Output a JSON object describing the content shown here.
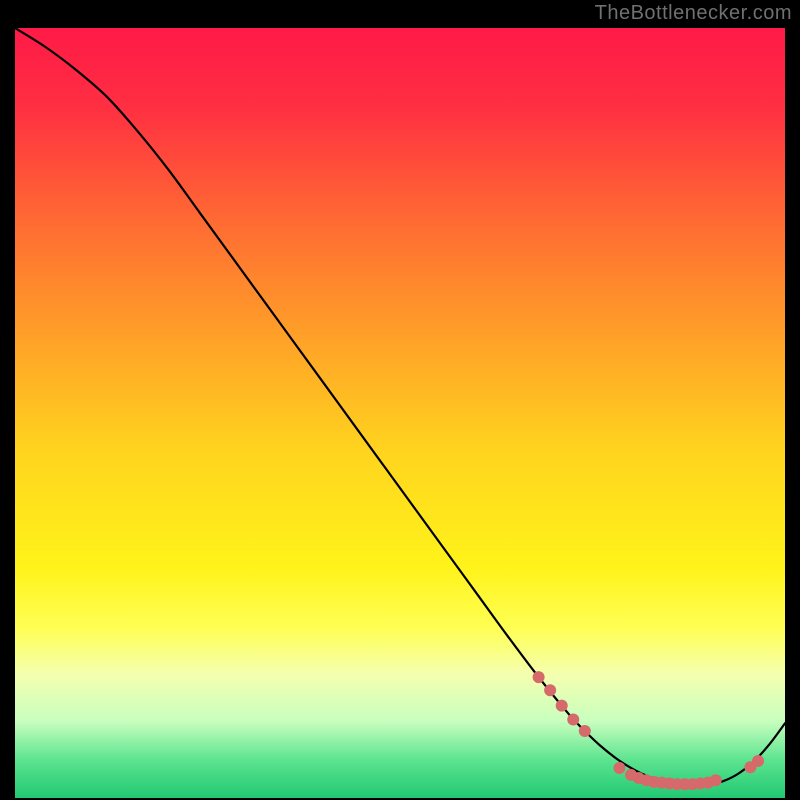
{
  "watermark": "TheBottlenecker.com",
  "chart_data": {
    "type": "line",
    "title": "",
    "xlabel": "",
    "ylabel": "",
    "xlim": [
      0,
      100
    ],
    "ylim": [
      0,
      100
    ],
    "gradient_stops": [
      {
        "offset": 0.0,
        "color": "#ff1a47"
      },
      {
        "offset": 0.1,
        "color": "#ff2e42"
      },
      {
        "offset": 0.25,
        "color": "#ff6a33"
      },
      {
        "offset": 0.4,
        "color": "#ffa028"
      },
      {
        "offset": 0.55,
        "color": "#ffd41e"
      },
      {
        "offset": 0.7,
        "color": "#fff31a"
      },
      {
        "offset": 0.78,
        "color": "#ffff55"
      },
      {
        "offset": 0.84,
        "color": "#f4ffb0"
      },
      {
        "offset": 0.9,
        "color": "#c8ffbe"
      },
      {
        "offset": 0.95,
        "color": "#5de490"
      },
      {
        "offset": 1.0,
        "color": "#22c873"
      }
    ],
    "series": [
      {
        "name": "bottleneck-curve",
        "x": [
          0,
          4,
          8,
          12,
          16,
          20,
          24,
          28,
          32,
          36,
          40,
          44,
          48,
          52,
          56,
          60,
          64,
          68,
          72,
          74,
          76,
          78,
          80,
          82,
          84,
          86,
          88,
          90,
          92,
          94,
          96,
          98,
          100
        ],
        "y": [
          100,
          97.5,
          94.5,
          91,
          86.5,
          81.5,
          76,
          70.5,
          65,
          59.5,
          54,
          48.5,
          43,
          37.5,
          32,
          26.5,
          21,
          15.7,
          10.8,
          8.7,
          6.8,
          5.2,
          3.9,
          2.9,
          2.2,
          1.8,
          1.6,
          1.7,
          2.2,
          3.2,
          4.8,
          7.0,
          9.7
        ]
      }
    ],
    "markers": {
      "name": "highlight-dots",
      "color": "#d66a6a",
      "radius": 6,
      "points": [
        {
          "x": 68.0,
          "y": 15.7
        },
        {
          "x": 69.5,
          "y": 14.0
        },
        {
          "x": 71.0,
          "y": 12.0
        },
        {
          "x": 72.5,
          "y": 10.2
        },
        {
          "x": 74.0,
          "y": 8.7
        },
        {
          "x": 78.5,
          "y": 3.9
        },
        {
          "x": 80.0,
          "y": 3.0
        },
        {
          "x": 81.0,
          "y": 2.6
        },
        {
          "x": 82.0,
          "y": 2.3
        },
        {
          "x": 83.0,
          "y": 2.1
        },
        {
          "x": 84.0,
          "y": 2.0
        },
        {
          "x": 85.0,
          "y": 1.9
        },
        {
          "x": 86.0,
          "y": 1.8
        },
        {
          "x": 87.0,
          "y": 1.8
        },
        {
          "x": 88.0,
          "y": 1.8
        },
        {
          "x": 89.0,
          "y": 1.9
        },
        {
          "x": 90.0,
          "y": 2.0
        },
        {
          "x": 91.0,
          "y": 2.3
        },
        {
          "x": 95.5,
          "y": 4.0
        },
        {
          "x": 96.5,
          "y": 4.8
        }
      ]
    }
  }
}
